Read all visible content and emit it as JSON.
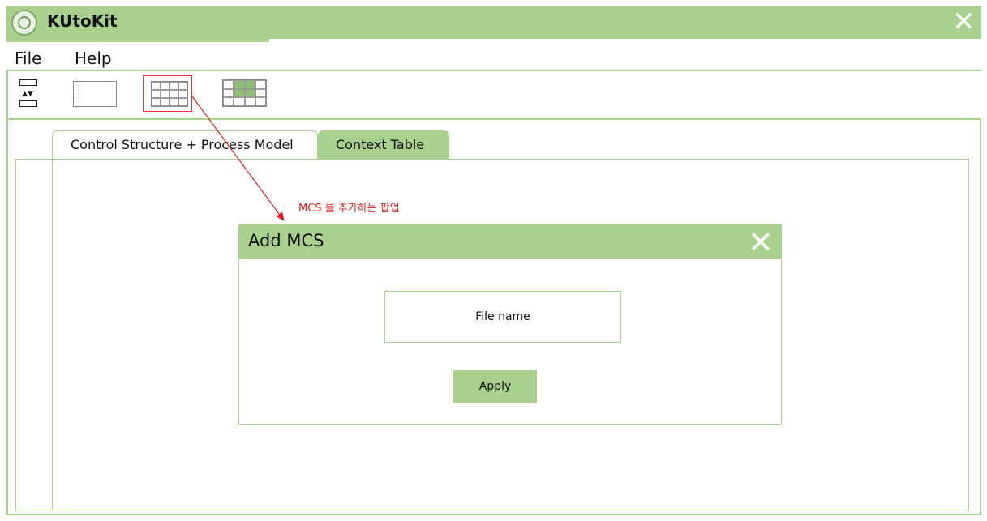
{
  "app": {
    "title": "KUtoKit",
    "close_icon": "close-icon",
    "close_glyph": "✕"
  },
  "menu": {
    "items": [
      {
        "label": "File"
      },
      {
        "label": "Help"
      }
    ]
  },
  "toolbar": {
    "tools": [
      {
        "icon": "control-structure-icon",
        "glyph": "▲▼"
      },
      {
        "icon": "list-icon"
      },
      {
        "icon": "table-icon",
        "selected": true
      },
      {
        "icon": "context-table-icon"
      }
    ]
  },
  "tabs": [
    {
      "label": "Control Structure + Process Model",
      "active": false
    },
    {
      "label": "Context Table",
      "active": true
    }
  ],
  "annotation": {
    "text": "MCS 를 추가하는 팝업",
    "color": "#e02020"
  },
  "dialog": {
    "title": "Add MCS",
    "close_glyph": "✕",
    "file_field_label": "File name",
    "apply_label": "Apply"
  },
  "colors": {
    "accent_green": "#a9d18e",
    "annotation_red": "#e02020"
  }
}
